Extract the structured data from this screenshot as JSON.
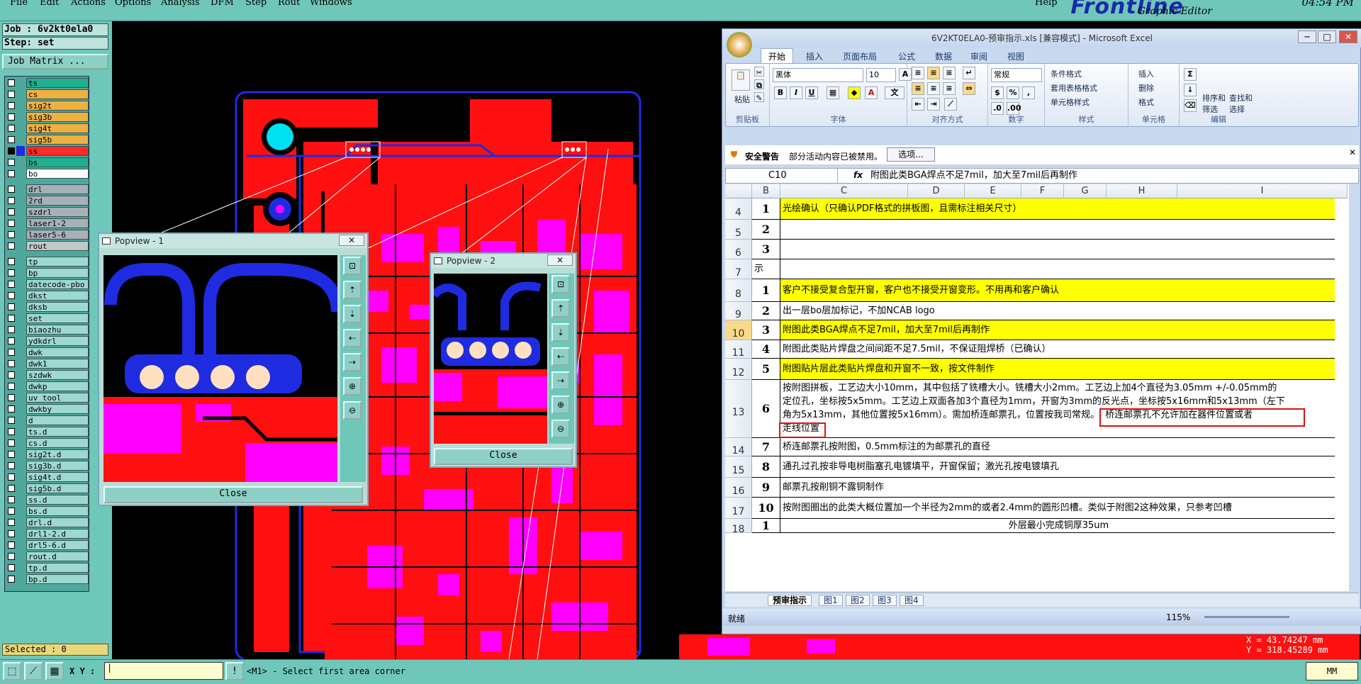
{
  "menu": {
    "items": [
      "File",
      "Edit",
      "Actions",
      "Options",
      "Analysis",
      "DFM",
      "Step",
      "Rout",
      "Windows"
    ],
    "help": "Help",
    "brand": "Frontline",
    "brand_sub": "Graphic Editor",
    "clock": "04:54 PM"
  },
  "left": {
    "job": "Job : 6v2kt0ela0",
    "step": "Step: set",
    "job_matrix": "Job Matrix ...",
    "selected": "Selected : 0",
    "layers": [
      {
        "name": "ts",
        "color": "#20b090",
        "checked": false
      },
      {
        "name": "cs",
        "color": "#f0b040",
        "checked": false
      },
      {
        "name": "sig2t",
        "color": "#f0b040",
        "checked": false
      },
      {
        "name": "sig3b",
        "color": "#f0b040",
        "checked": false
      },
      {
        "name": "sig4t",
        "color": "#f0b040",
        "checked": false
      },
      {
        "name": "sig5b",
        "color": "#f0b040",
        "checked": false
      },
      {
        "name": "ss",
        "color": "#ff2a2a",
        "checked": true
      },
      {
        "name": "bs",
        "color": "#20b090",
        "checked": false
      },
      {
        "name": "bo",
        "color": "#ffffff",
        "checked": false
      },
      {
        "name": "drl",
        "color": "#a8b0b8",
        "checked": false
      },
      {
        "name": "2rd",
        "color": "#a8b0b8",
        "checked": false
      },
      {
        "name": "szdrl",
        "color": "#a8b0b8",
        "checked": false
      },
      {
        "name": "laser1-2",
        "color": "#a8b0b8",
        "checked": false
      },
      {
        "name": "laser5-6",
        "color": "#a8b0b8",
        "checked": false
      },
      {
        "name": "rout",
        "color": "#c0c8c8",
        "checked": false
      },
      {
        "name": "tp",
        "color": "#9fd8d0",
        "checked": false
      },
      {
        "name": "bp",
        "color": "#9fd8d0",
        "checked": false
      },
      {
        "name": "datecode-pbo",
        "color": "#9fd8d0",
        "checked": false
      },
      {
        "name": "dkst",
        "color": "#9fd8d0",
        "checked": false
      },
      {
        "name": "dksb",
        "color": "#9fd8d0",
        "checked": false
      },
      {
        "name": "set",
        "color": "#9fd8d0",
        "checked": false
      },
      {
        "name": "biaozhu",
        "color": "#9fd8d0",
        "checked": false
      },
      {
        "name": "ydkdrl",
        "color": "#9fd8d0",
        "checked": false
      },
      {
        "name": "dwk",
        "color": "#9fd8d0",
        "checked": false
      },
      {
        "name": "dwk1",
        "color": "#9fd8d0",
        "checked": false
      },
      {
        "name": "szdwk",
        "color": "#9fd8d0",
        "checked": false
      },
      {
        "name": "dwkp",
        "color": "#9fd8d0",
        "checked": false
      },
      {
        "name": "uv_tool",
        "color": "#9fd8d0",
        "checked": false
      },
      {
        "name": "dwkby",
        "color": "#9fd8d0",
        "checked": false
      },
      {
        "name": "d",
        "color": "#9fd8d0",
        "checked": false
      },
      {
        "name": "ts.d",
        "color": "#9fd8d0",
        "checked": false
      },
      {
        "name": "cs.d",
        "color": "#9fd8d0",
        "checked": false
      },
      {
        "name": "sig2t.d",
        "color": "#9fd8d0",
        "checked": false
      },
      {
        "name": "sig3b.d",
        "color": "#9fd8d0",
        "checked": false
      },
      {
        "name": "sig4t.d",
        "color": "#9fd8d0",
        "checked": false
      },
      {
        "name": "sig5b.d",
        "color": "#9fd8d0",
        "checked": false
      },
      {
        "name": "ss.d",
        "color": "#9fd8d0",
        "checked": false
      },
      {
        "name": "bs.d",
        "color": "#9fd8d0",
        "checked": false
      },
      {
        "name": "drl.d",
        "color": "#9fd8d0",
        "checked": false
      },
      {
        "name": "drl1-2.d",
        "color": "#9fd8d0",
        "checked": false
      },
      {
        "name": "drl5-6.d",
        "color": "#9fd8d0",
        "checked": false
      },
      {
        "name": "rout.d",
        "color": "#9fd8d0",
        "checked": false
      },
      {
        "name": "tp.d",
        "color": "#9fd8d0",
        "checked": false
      },
      {
        "name": "bp.d",
        "color": "#9fd8d0",
        "checked": false
      }
    ]
  },
  "bottom": {
    "xy_label": "X Y :",
    "status": "<M1> - Select first area corner",
    "unit": "MM",
    "coord_x": "X = 43.74247 mm",
    "coord_y": "Y = 318.45289 mm"
  },
  "popview1": {
    "title": "Popview - 1",
    "close": "Close"
  },
  "popview2": {
    "title": "Popview - 2",
    "close": "Close"
  },
  "excel": {
    "title": "6V2KT0ELA0-预审指示.xls  [兼容模式] - Microsoft Excel",
    "tabs": [
      "开始",
      "插入",
      "页面布局",
      "公式",
      "数据",
      "审阅",
      "视图"
    ],
    "ribbon": {
      "paste": "粘贴",
      "clipboard": "剪贴板",
      "font_name": "黑体",
      "font_size": "10",
      "font_group": "字体",
      "align_group": "对齐方式",
      "number_format": "常规",
      "number_group": "数字",
      "cond_format": "条件格式",
      "table_format": "套用表格格式",
      "cell_style": "单元格样式",
      "style_group": "样式",
      "insert": "插入",
      "delete": "删除",
      "format": "格式",
      "cells_group": "单元格",
      "sort": "排序和筛选",
      "find": "查找和选择",
      "edit_group": "编辑"
    },
    "security_label": "安全警告",
    "security_text": "部分活动内容已被禁用。",
    "security_btn": "选项...",
    "namebox": "C10",
    "fx": "fx",
    "formula": "附图此类BGA焊点不足7mil，加大至7mil后再制作",
    "columns": [
      "B",
      "C",
      "D",
      "E",
      "F",
      "G",
      "H",
      "I"
    ],
    "rows": [
      {
        "row": "4",
        "num": "1",
        "text": "光绘确认（只确认PDF格式的拼板图，且需标注相关尺寸）",
        "yellow": true
      },
      {
        "row": "5",
        "num": "2",
        "text": "",
        "yellow": false
      },
      {
        "row": "6",
        "num": "3",
        "text": "",
        "yellow": false
      },
      {
        "row": "7",
        "num": "",
        "text": "示",
        "yellow": false
      },
      {
        "row": "8",
        "num": "1",
        "text": "客户不接受复合型开窗，客户也不接受开窗变形。不用再和客户确认",
        "yellow": true
      },
      {
        "row": "9",
        "num": "2",
        "text": "出一层bo层加标记，不加NCAB logo",
        "yellow": false
      },
      {
        "row": "10",
        "num": "3",
        "text": "附图此类BGA焊点不足7mil，加大至7mil后再制作",
        "yellow": true
      },
      {
        "row": "11",
        "num": "4",
        "text": "附图此类贴片焊盘之间间距不足7.5mil，不保证阻焊桥（已确认）",
        "yellow": false
      },
      {
        "row": "12",
        "num": "5",
        "text": "附图贴片层此类贴片焊盘和开窗不一致，按文件制作",
        "yellow": true
      },
      {
        "row": "13",
        "num": "6",
        "text": "按附图拼板，工艺边大小10mm，其中包括了铣槽大小。铣槽大小2mm。工艺边上加4个直径为3.05mm +/-0.05mm的",
        "line2": "定位孔，坐标按5x5mm。工艺边上双面各加3个直径为1mm，开窗为3mm的反光点，坐标按5x16mm和5x13mm（左下",
        "line3": "角为5x13mm，其他位置按5x16mm）。需加桥连邮票孔，位置按我司常规。",
        "line3b": "桥连邮票孔不允许加在器件位置或者",
        "line4": "走线位置",
        "yellow": false
      },
      {
        "row": "14",
        "num": "7",
        "text": "桥连邮票孔按附图，0.5mm标注的为邮票孔的直径",
        "yellow": false
      },
      {
        "row": "15",
        "num": "8",
        "text": "通孔过孔按非导电树脂塞孔电镀填平，开窗保留；激光孔按电镀填孔",
        "yellow": false
      },
      {
        "row": "16",
        "num": "9",
        "text": "邮票孔按削铜不露铜制作",
        "yellow": false
      },
      {
        "row": "17",
        "num": "10",
        "text": "按附图圈出的此类大概位置加一个半径为2mm的或者2.4mm的圆形凹槽。类似于附图2这种效果，只参考凹槽",
        "yellow": false
      },
      {
        "row": "18",
        "num": "1",
        "text": "外层最小完成铜厚35um",
        "yellow": false
      }
    ],
    "sheet_tabs": [
      "预审指示",
      "图1",
      "图2",
      "图3",
      "图4"
    ],
    "status_ready": "就绪",
    "zoom": "115%"
  }
}
